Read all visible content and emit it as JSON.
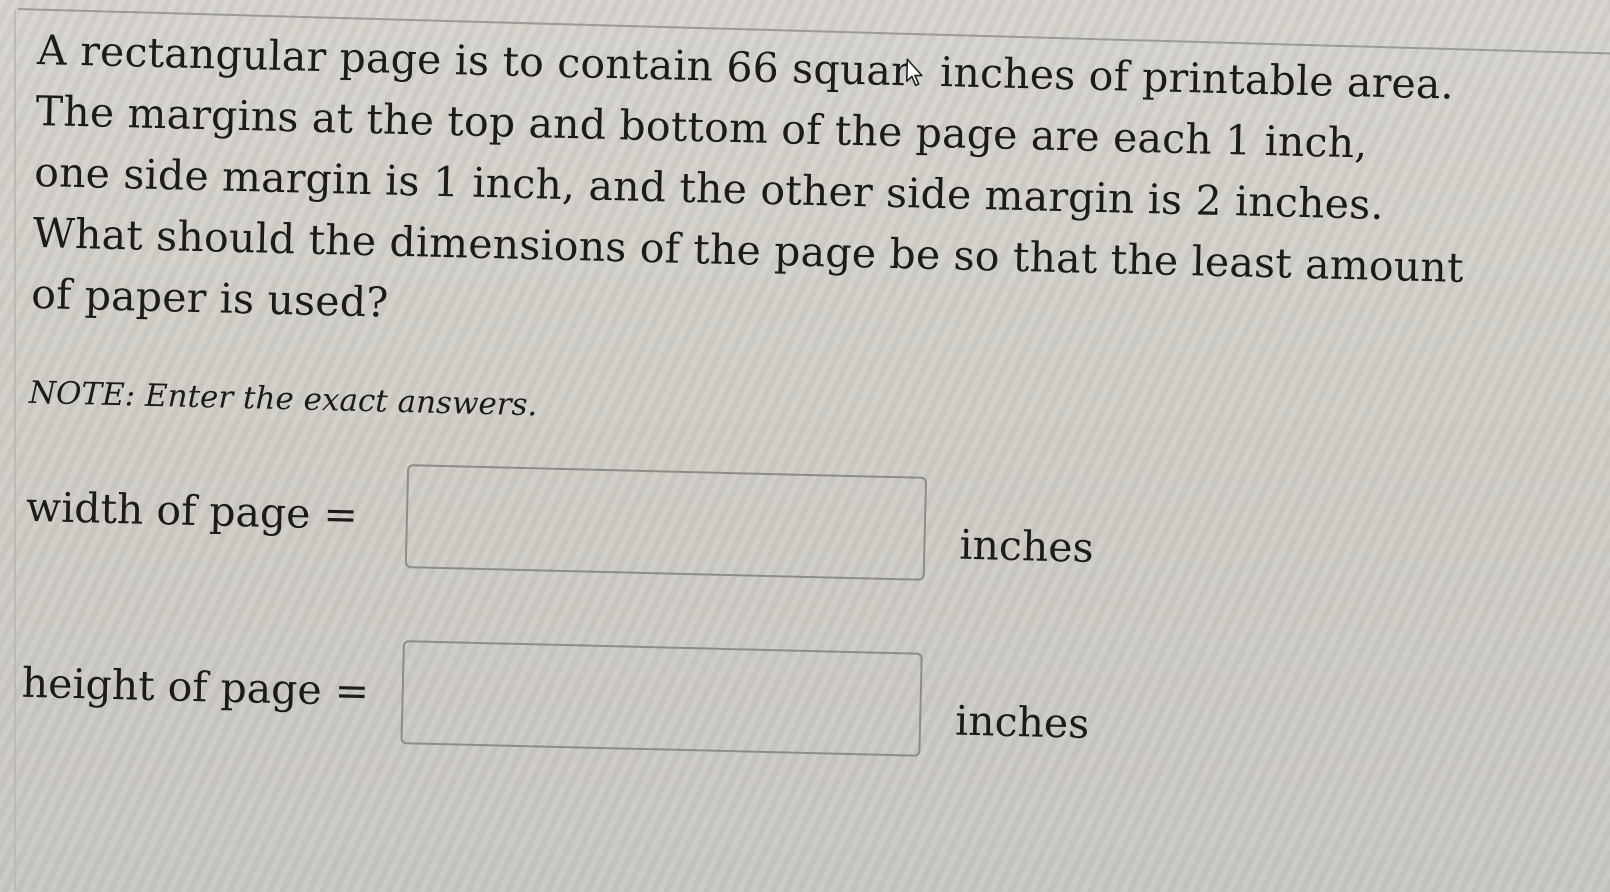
{
  "problem": {
    "line1_before_cursor": "A rectangular page is to contain 66 squar",
    "line1_after_cursor": " inches of printable area.",
    "line2": "The margins at the top and bottom of the page are each 1 inch,",
    "line3": "one side margin is 1 inch, and the other side margin is 2 inches.",
    "line4": "What should the dimensions of the page be so that the least amount",
    "line5": "of paper is used?"
  },
  "note": "NOTE: Enter the exact answers.",
  "answers": [
    {
      "label": "width of page =",
      "value": "",
      "unit": "inches"
    },
    {
      "label": "height of page =",
      "value": "",
      "unit": "inches"
    }
  ],
  "mouse_cursor": "arrow-pointer-icon"
}
